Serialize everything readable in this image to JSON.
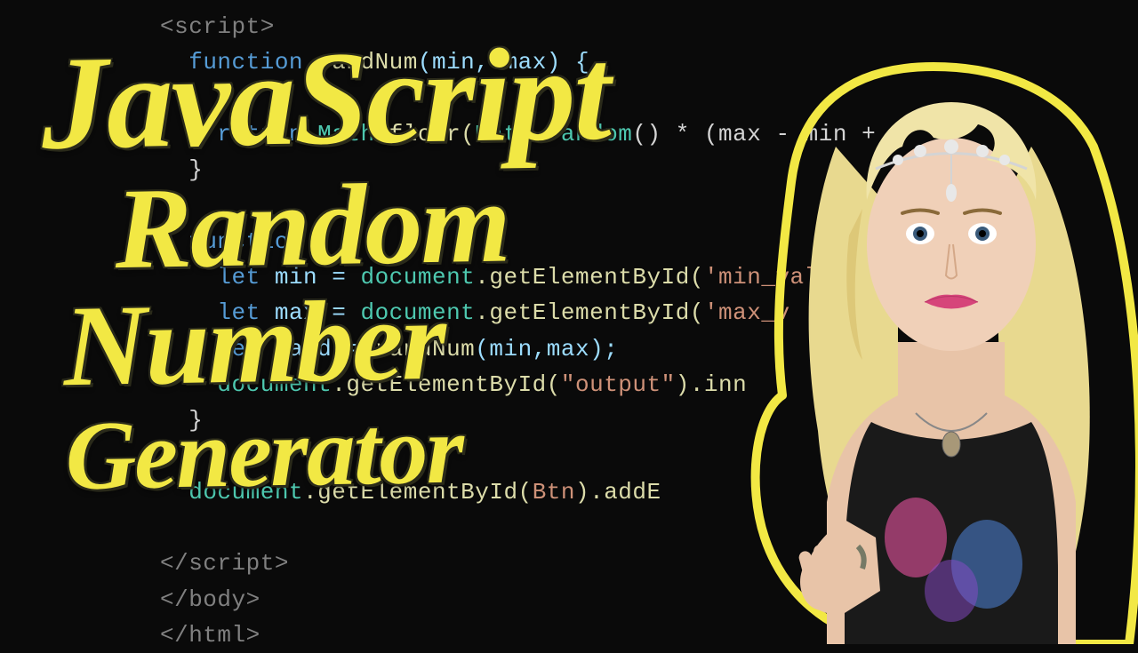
{
  "title": {
    "line1": "JavaScript",
    "line2": "Random",
    "line3": "Number",
    "line4": "Generator"
  },
  "code": {
    "l1_open": "<script>",
    "l2_kw": "function ",
    "l2_fn": "randNum",
    "l2_params": "(min, max) {",
    "l3_ret": "return ",
    "l3_math": "Math",
    "l3_floor": ".floor(",
    "l3_rand": "Math.random",
    "l3_rest": "() * (max - min +",
    "l4": "}",
    "l5_fn": "function",
    "l6_let": "let ",
    "l6_min": "min = ",
    "l6_doc": "document",
    "l6_get": ".getElementById(",
    "l6_str": "'min_value'",
    "l7_let": "let ",
    "l7_max": "max = ",
    "l7_doc": "document",
    "l7_get": ".getElementById(",
    "l7_str": "'max_v",
    "l8_let": "let ",
    "l8_rand": "rand = ",
    "l8_fn": "randNum",
    "l8_args": "(min,max);",
    "l9_doc": "document",
    "l9_get": ".getElementById(",
    "l9_str": "\"output\"",
    "l9_inn": ").inn",
    "l10": "}",
    "l11_doc": "document",
    "l11_get": ".getElementById(",
    "l11_btn": "Btn",
    "l11_add": ").addE",
    "l12": "</script>",
    "l13": "</body>",
    "l14": "</html>"
  }
}
